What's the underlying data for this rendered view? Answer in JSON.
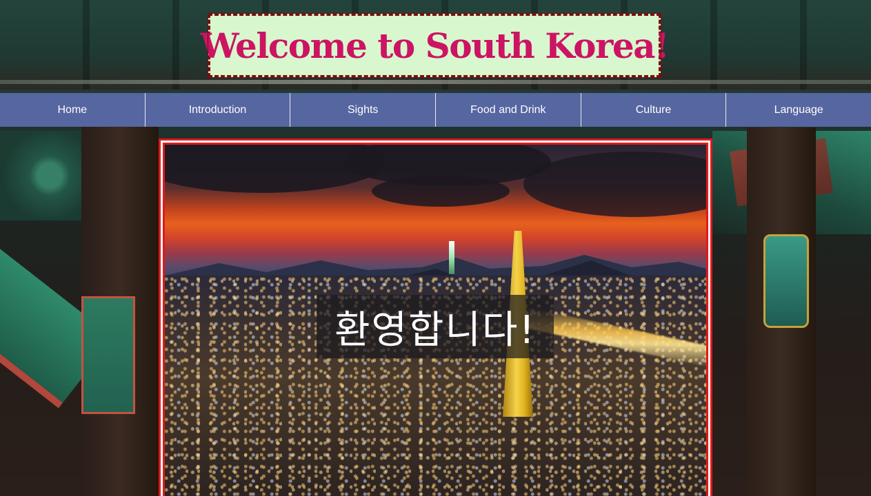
{
  "header": {
    "title": "Welcome to South Korea!"
  },
  "nav": {
    "items": [
      {
        "label": "Home"
      },
      {
        "label": "Introduction"
      },
      {
        "label": "Sights"
      },
      {
        "label": "Food and Drink"
      },
      {
        "label": "Culture"
      },
      {
        "label": "Language"
      }
    ]
  },
  "hero": {
    "overlay_text": "환영합니다!"
  },
  "colors": {
    "title_text": "#cc1463",
    "title_bg": "#d8f7cf",
    "title_border": "#7a0e0e",
    "nav_bg": "#5666a0",
    "hero_border": "#e01a1a"
  }
}
